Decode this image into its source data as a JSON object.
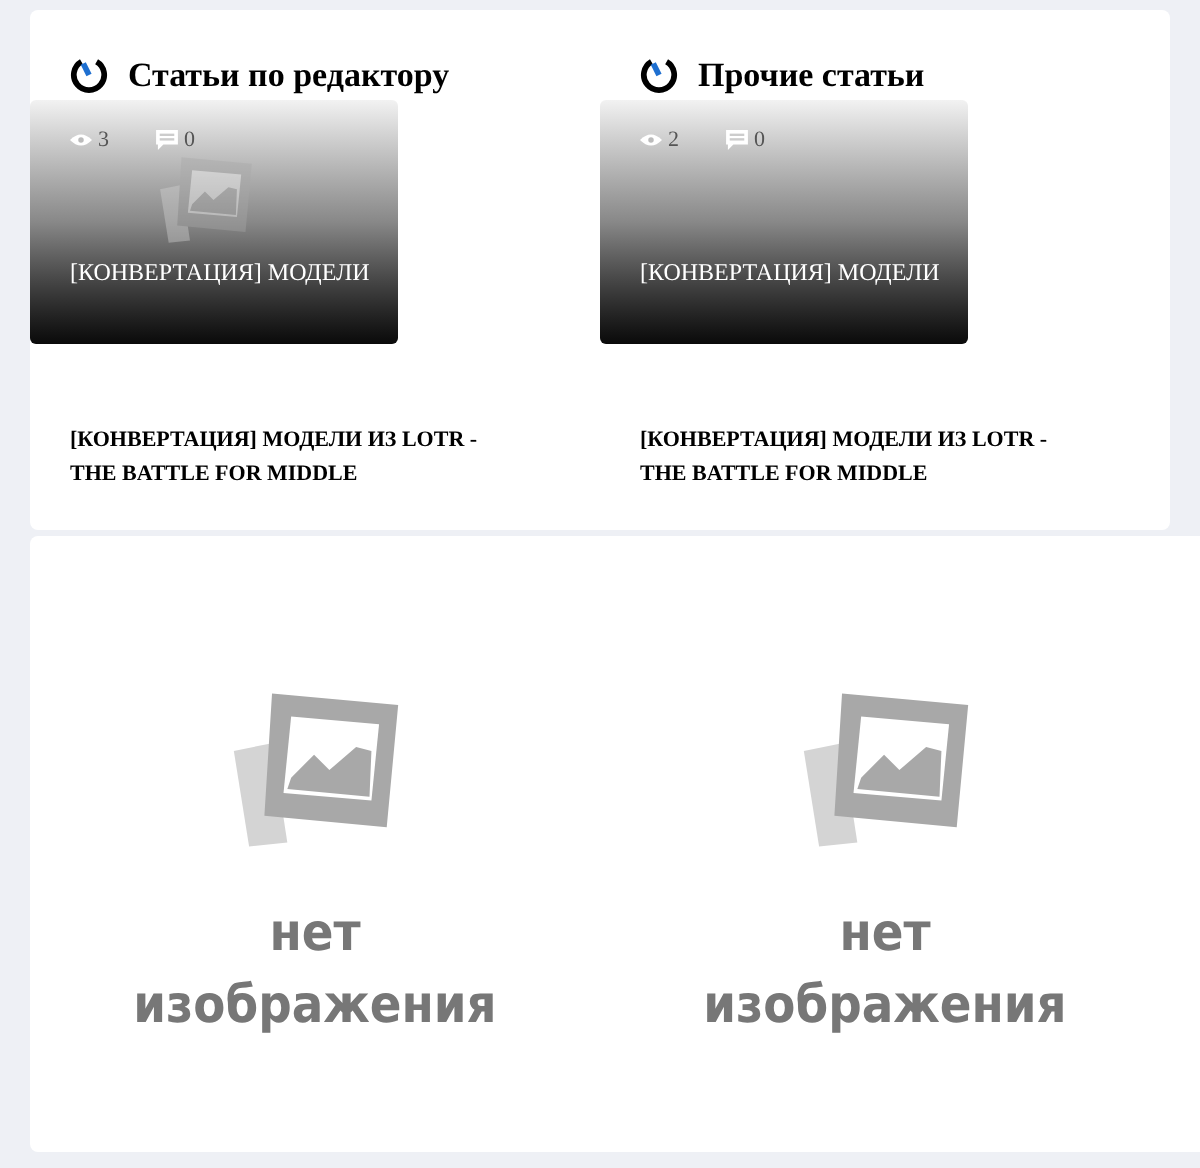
{
  "sections": [
    {
      "heading": "Статьи по редактору",
      "thumb": {
        "views": "3",
        "comments": "0",
        "caption": "[КОНВЕРТАЦИЯ] МОДЕЛИ",
        "placeholder_icon": true
      },
      "title": "[КОНВЕРТАЦИЯ] МОДЕЛИ ИЗ LOTR - THE BATTLE FOR MIDDLE"
    },
    {
      "heading": "Прочие статьи",
      "thumb": {
        "views": "2",
        "comments": "0",
        "caption": "[КОНВЕРТАЦИЯ] МОДЕЛИ",
        "placeholder_icon": false
      },
      "title": "[КОНВЕРТАЦИЯ] МОДЕЛИ ИЗ LOTR - THE BATTLE FOR MIDDLE"
    }
  ],
  "placeholders": [
    {
      "line1": "нет",
      "line2": "изображения"
    },
    {
      "line1": "нет",
      "line2": "изображения"
    }
  ]
}
